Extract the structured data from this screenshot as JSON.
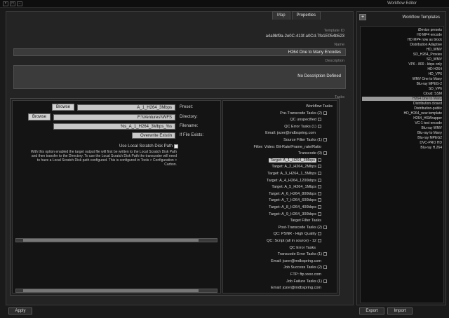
{
  "window": {
    "title": "Workflow Editor",
    "controls": [
      "–",
      "□",
      "×"
    ]
  },
  "editor": {
    "tabs": [
      {
        "label": "Properties"
      },
      {
        "label": "Map"
      }
    ],
    "template_id_label": "Template ID",
    "template_id": "a4a9bf9a-2e0C-413f-a0Cd-7fe1E054b523",
    "name_label": "Name",
    "name": "H264 One to Many Encodes",
    "description_label": "Description",
    "description": "No Description Defined",
    "tasks_label": "Tasks",
    "apply_label": "Apply"
  },
  "tree": [
    {
      "text": "Workflow Tasks",
      "level": 0,
      "box": false
    },
    {
      "text": "Pre-Transcode Tasks (2)",
      "level": 1,
      "box": true
    },
    {
      "text": "QC unspecified",
      "level": 2,
      "box": true
    },
    {
      "text": "QC Error Tasks (1)",
      "level": 2,
      "box": true
    },
    {
      "text": "Email: jozer@mdbspring.com",
      "level": 3,
      "box": false
    },
    {
      "text": "Source Filter Tasks (1)",
      "level": 1,
      "box": true
    },
    {
      "text": "Filter: Video: Bit-Rate/Frame_rate/Ratio",
      "level": 2,
      "box": false
    },
    {
      "text": "Transcode (9)",
      "level": 1,
      "box": true
    },
    {
      "text": "Target: A_1_H264_3Mbps",
      "level": 2,
      "box": true,
      "selected": true
    },
    {
      "text": "Target: A_2_H264_2Mbps",
      "level": 2,
      "box": true
    },
    {
      "text": "Target: A_3_H264_1_5Mbps",
      "level": 2,
      "box": true
    },
    {
      "text": "Target: A_4_H264_1200kbps",
      "level": 2,
      "box": true
    },
    {
      "text": "Target: A_5_H264_1Mbps",
      "level": 2,
      "box": true
    },
    {
      "text": "Target: A_6_H264_800kbps",
      "level": 2,
      "box": true
    },
    {
      "text": "Target: A_7_H264_600kbps",
      "level": 2,
      "box": true
    },
    {
      "text": "Target: A_8_H264_400kbps",
      "level": 2,
      "box": true
    },
    {
      "text": "Target: A_9_H264_300kbps",
      "level": 2,
      "box": true
    },
    {
      "text": "Target Filter Tasks",
      "level": 2,
      "box": false
    },
    {
      "text": "Post-Transcode Tasks (2)",
      "level": 1,
      "box": true
    },
    {
      "text": "QC: PSNR - High Quality",
      "level": 2,
      "box": true
    },
    {
      "text": "QC: Script (all in source) - 12",
      "level": 2,
      "box": true
    },
    {
      "text": "QC Error Tasks",
      "level": 3,
      "box": false
    },
    {
      "text": "Transcode Error Tasks (1)",
      "level": 1,
      "box": true
    },
    {
      "text": "Email: jozer@mdbspring.com",
      "level": 2,
      "box": false
    },
    {
      "text": "Job Success Tasks (2)",
      "level": 1,
      "box": true
    },
    {
      "text": "FTP: ftp.xxxx.com",
      "level": 2,
      "box": false
    },
    {
      "text": "Job Failure Tasks (1)",
      "level": 1,
      "box": true
    },
    {
      "text": "Email: jozer@mdbspring.com",
      "level": 2,
      "box": false
    }
  ],
  "props": {
    "preset_label": "Preset:",
    "preset_value": "A_1_H264_3Mbps",
    "directory_label": "Directory:",
    "directory_value": "F:\\\\Ventures\\\\WFS",
    "filename_label": "Filename:",
    "filename_value": "%s_A_1_H264_3Mbps_%s",
    "file_exists_label": "If File Exists:",
    "file_exists_value": "Overwrite Existin",
    "browse_label": "Browse",
    "scratch_label": "Use Local Scratch Disk Path",
    "scratch_desc": "With this option enabled the target output file will first be written to the Local Scratch Disk Path and then transfer to the Directory. To use the Local Scratch Disk Path the transcoder will need to have a Local Scratch Disk path configured. This is configured in Tools > Configuration > Carbon."
  },
  "right": {
    "header": "Workflow Templates",
    "add_label": "+",
    "import_label": "Import",
    "export_label": "Export",
    "templates": [
      "iDevice presets",
      "H0 MP4 encode",
      "HD MP4 now as block",
      "Distribution Adaptive",
      "HD_WMV",
      "SD_H264_Proxies",
      "SD_WMV",
      "VP6 - 800 - kbps only",
      "HD H264",
      "HD_VP6",
      "WMV One to Many",
      "Blu-ray MPEG-2",
      "SD_VP6",
      "Cloud: SSM",
      "H264 One to Many",
      "Distribution closed",
      "Distribution-public",
      "HD_H264_new template",
      "H264_HSWrapper",
      "VC-1 test encode",
      "Blu-ray WMV",
      "Blu-ray to Many",
      "Blu-ray MPEG2",
      "DVC-PRO HD",
      "Blu-ray H.264"
    ],
    "selected_index": 14
  }
}
